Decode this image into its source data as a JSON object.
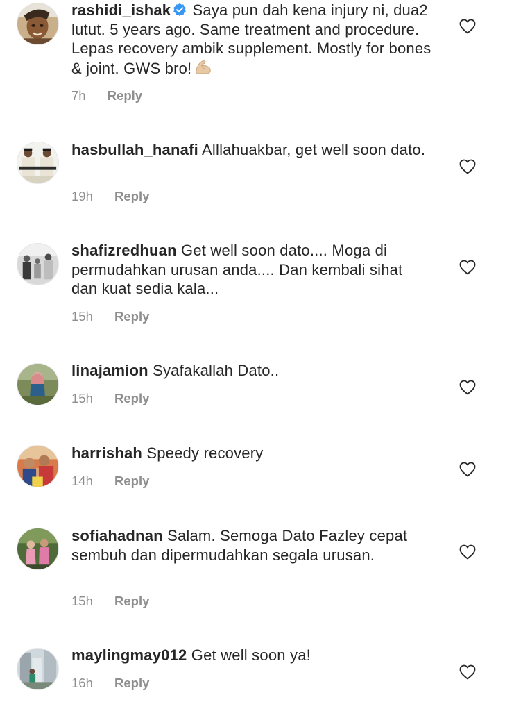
{
  "comments": [
    {
      "username": "rashidi_ishak",
      "verified": true,
      "text": "Saya pun dah kena injury ni, dua2 lutut. 5 years ago. Same treatment and procedure. Lepas recovery ambik supplement. Mostly for bones & joint. GWS bro!",
      "emoji": "flexed-biceps-icon",
      "time": "7h",
      "reply": "Reply"
    },
    {
      "username": "hasbullah_hanafi",
      "text": "Alllahuakbar, get well soon dato.",
      "time": "19h",
      "reply": "Reply"
    },
    {
      "username": "shafizredhuan",
      "text": "Get well soon dato.... Moga di permudahkan urusan anda.... Dan kembali sihat dan kuat sedia kala...",
      "time": "15h",
      "reply": "Reply"
    },
    {
      "username": "linajamion",
      "text": "Syafakallah Dato..",
      "time": "15h",
      "reply": "Reply"
    },
    {
      "username": "harrishah",
      "text": "Speedy recovery",
      "time": "14h",
      "reply": "Reply"
    },
    {
      "username": "sofiahadnan",
      "text": "Salam. Semoga Dato Fazley cepat sembuh dan dipermudahkan segala urusan.",
      "time": "15h",
      "reply": "Reply"
    },
    {
      "username": "maylingmay012",
      "text": "Get well soon ya!",
      "time": "16h",
      "reply": "Reply"
    }
  ],
  "icons": {
    "like": "heart-outline-icon",
    "verified": "verified-badge-icon"
  },
  "colors": {
    "text": "#262626",
    "meta": "#8e8e8e",
    "verified": "#3897f0",
    "background": "#ffffff"
  }
}
